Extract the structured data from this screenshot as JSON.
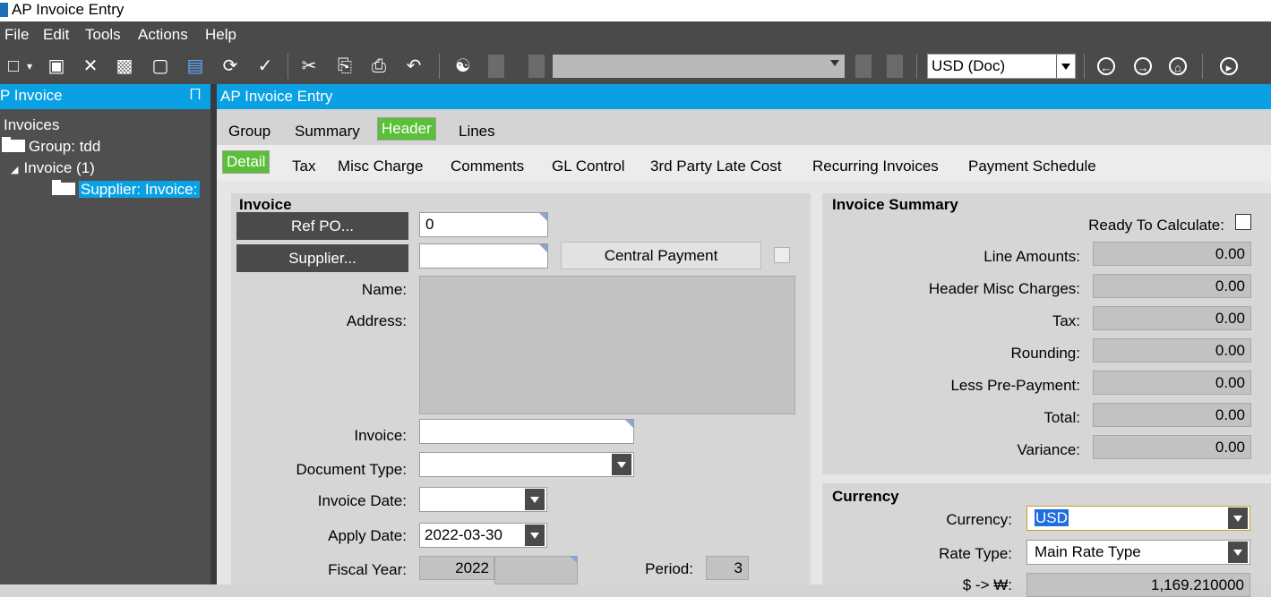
{
  "window": {
    "title": "AP Invoice Entry"
  },
  "menu": [
    "File",
    "Edit",
    "Tools",
    "Actions",
    "Help"
  ],
  "toolbar": {
    "currency_label": "USD (Doc)",
    "record_selector": ""
  },
  "left_panel": {
    "title": "P Invoice",
    "pin": "⨅",
    "tree": {
      "root": "Invoices",
      "group": "Group: tdd",
      "invoice": "Invoice (1)",
      "supplier": "Supplier: Invoice:"
    }
  },
  "main": {
    "title": "AP Invoice Entry"
  },
  "tabs_top": [
    {
      "label": "Group",
      "active": false
    },
    {
      "label": "Summary",
      "active": false
    },
    {
      "label": "Header",
      "active": true
    },
    {
      "label": "Lines",
      "active": false
    }
  ],
  "tabs_sub": [
    {
      "label": "Detail",
      "active": true
    },
    {
      "label": "Tax",
      "active": false
    },
    {
      "label": "Misc Charge",
      "active": false
    },
    {
      "label": "Comments",
      "active": false
    },
    {
      "label": "GL Control",
      "active": false
    },
    {
      "label": "3rd Party Late Cost",
      "active": false
    },
    {
      "label": "Recurring Invoices",
      "active": false
    },
    {
      "label": "Payment Schedule",
      "active": false
    }
  ],
  "invoice_group": {
    "title": "Invoice",
    "ref_po_button": "Ref PO...",
    "ref_po_value": "0",
    "supplier_button": "Supplier...",
    "supplier_value": "",
    "central_payment_button": "Central Payment",
    "name_label": "Name:",
    "address_label": "Address:",
    "invoice_label": "Invoice:",
    "invoice_value": "",
    "document_type_label": "Document Type:",
    "document_type_value": "",
    "invoice_date_label": "Invoice Date:",
    "invoice_date_value": "",
    "apply_date_label": "Apply Date:",
    "apply_date_value": "2022-03-30",
    "fiscal_year_label": "Fiscal Year:",
    "fiscal_year_value": "2022",
    "period_label": "Period:",
    "period_value": "3"
  },
  "summary_group": {
    "title": "Invoice Summary",
    "ready_label": "Ready To Calculate:",
    "rows": [
      {
        "label": "Line Amounts:",
        "value": "0.00"
      },
      {
        "label": "Header Misc Charges:",
        "value": "0.00"
      },
      {
        "label": "Tax:",
        "value": "0.00"
      },
      {
        "label": "Rounding:",
        "value": "0.00"
      },
      {
        "label": "Less Pre-Payment:",
        "value": "0.00"
      },
      {
        "label": "Total:",
        "value": "0.00"
      },
      {
        "label": "Variance:",
        "value": "0.00"
      }
    ]
  },
  "currency_group": {
    "title": "Currency",
    "currency_label": "Currency:",
    "currency_value": "USD",
    "rate_type_label": "Rate Type:",
    "rate_type_value": "Main Rate Type",
    "rate_label": "$ -> ₩:",
    "rate_value": "1,169.210000"
  },
  "colors": {
    "accent": "#0aa1e4",
    "active_tab": "#5cbf3a",
    "dark": "#4a4a4a"
  }
}
